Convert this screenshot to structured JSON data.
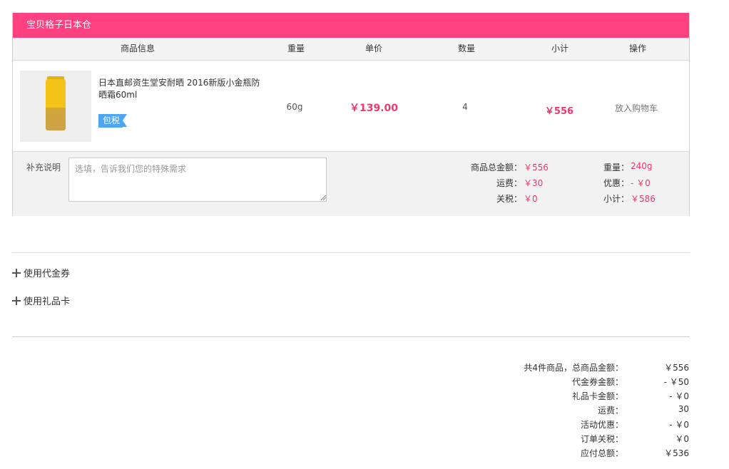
{
  "store": {
    "title": "宝贝格子日本仓"
  },
  "columns": [
    "商品信息",
    "重量",
    "单价",
    "数量",
    "小计",
    "操作"
  ],
  "item": {
    "name": "日本直邮资生堂安耐晒 2016新版小金瓶防晒霜60ml",
    "tag": "包税",
    "weight": "60g",
    "price": "￥139.00",
    "quantity": "4",
    "subtotal": "￥556",
    "action": "放入购物车"
  },
  "remark": {
    "label": "补充说明",
    "placeholder": "选填，告诉我们您的特殊需求"
  },
  "summary": {
    "goods_total_label": "商品总金额：",
    "goods_total": "￥556",
    "shipping_label": "运费：",
    "shipping": "￥30",
    "tax_label": "关税：",
    "tax": "￥0",
    "weight_label": "重量：",
    "weight": "240g",
    "discount_label": "优惠：",
    "discount": "- ￥0",
    "subtotal_label": "小计：",
    "subtotal": "￥586"
  },
  "options": {
    "voucher": "使用代金券",
    "giftcard": "使用礼品卡"
  },
  "totals": [
    {
      "label": "共4件商品，总商品金额：",
      "value": "￥556"
    },
    {
      "label": "代金券金额：",
      "value": "- ￥50"
    },
    {
      "label": "礼品卡金额：",
      "value": "- ￥0"
    },
    {
      "label": "运费：",
      "value": "30"
    },
    {
      "label": "活动优惠：",
      "value": "- ￥0"
    },
    {
      "label": "订单关税：",
      "value": "￥0"
    },
    {
      "label": "应付总额：",
      "value": "￥536"
    }
  ],
  "colors": {
    "accent": "#ff4081",
    "price": "#f0386b",
    "tag": "#4da6f3"
  }
}
